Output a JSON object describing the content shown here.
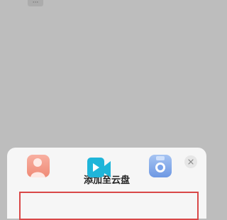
{
  "top_bar": {
    "more_label": "···"
  },
  "sheet": {
    "title": "添加至云盘",
    "options": [
      {
        "icon": "photo-icon",
        "color": "#f29480"
      },
      {
        "icon": "video-icon",
        "color": "#1fb5d9"
      },
      {
        "icon": "camera-icon",
        "color": "#7aa3ea"
      }
    ]
  },
  "colors": {
    "highlight_border": "#d94848",
    "backdrop": "#bdbdbd",
    "sheet_bg": "#f6f6f6"
  }
}
